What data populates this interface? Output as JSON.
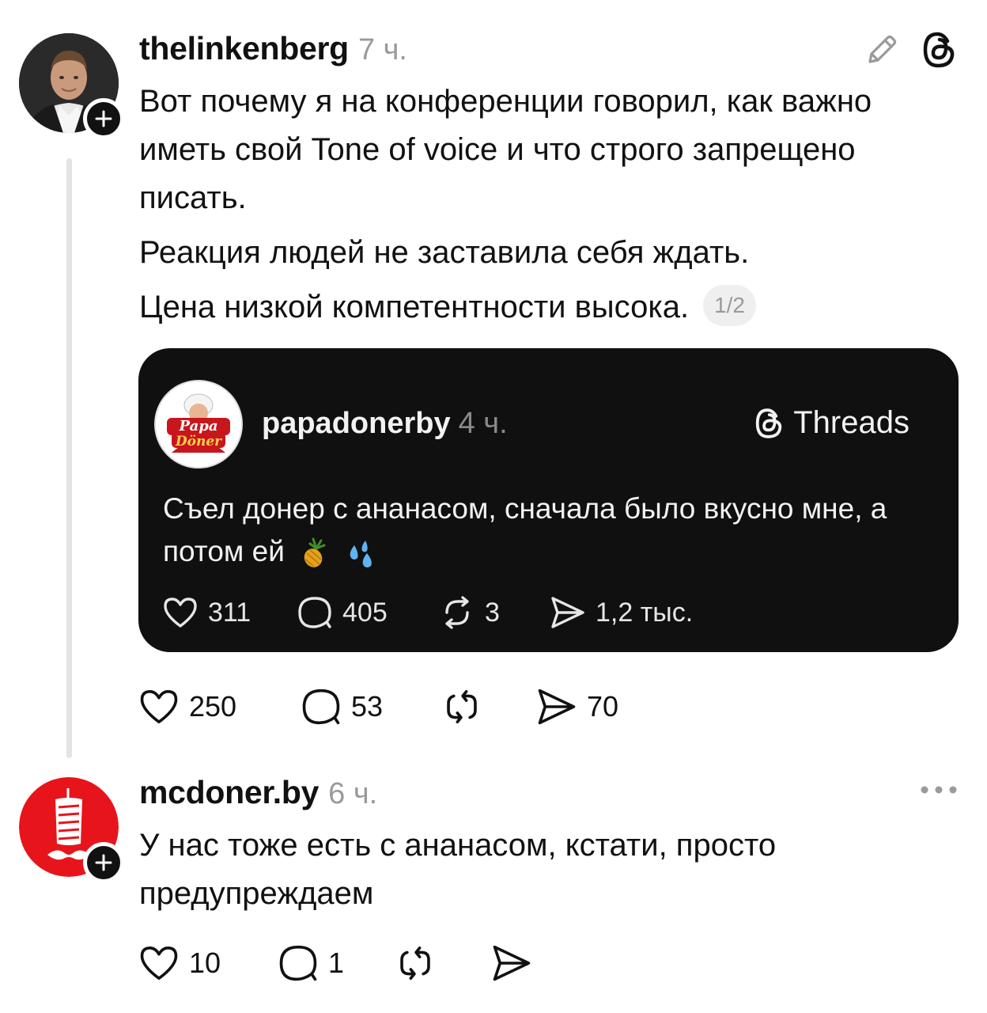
{
  "post1": {
    "username": "thelinkenberg",
    "time": "7 ч.",
    "paragraphs": [
      "Вот почему я на конференции говорил, как важно иметь свой Tone of voice и что строго запрещено писать.",
      "Реакция людей не заставила себя ждать.",
      "Цена низкой компетентности высока."
    ],
    "page_badge": "1/2",
    "quote": {
      "username": "papadonerby",
      "time": "4 ч.",
      "brand": "Threads",
      "text": "Съел донер с ананасом, сначала было вкусно мне, а потом ей",
      "likes": "311",
      "replies": "405",
      "reposts": "3",
      "shares": "1,2 тыс."
    },
    "likes": "250",
    "replies": "53",
    "shares": "70"
  },
  "post2": {
    "username": "mcdoner.by",
    "time": "6 ч.",
    "text": "У нас тоже есть с ананасом, кстати, просто предупреждаем",
    "likes": "10",
    "replies": "1"
  },
  "colors": {
    "text": "#111111",
    "muted": "#9a9a9a",
    "card_bg": "#101010",
    "mcdoner_red": "#e8141b",
    "thread_line": "#e4e4e4"
  },
  "icons": [
    "pencil-icon",
    "threads-logo-icon",
    "heart-icon",
    "comment-icon",
    "repost-icon",
    "send-icon",
    "more-icon",
    "plus-icon",
    "pineapple-emoji",
    "sweat-droplets-emoji"
  ]
}
